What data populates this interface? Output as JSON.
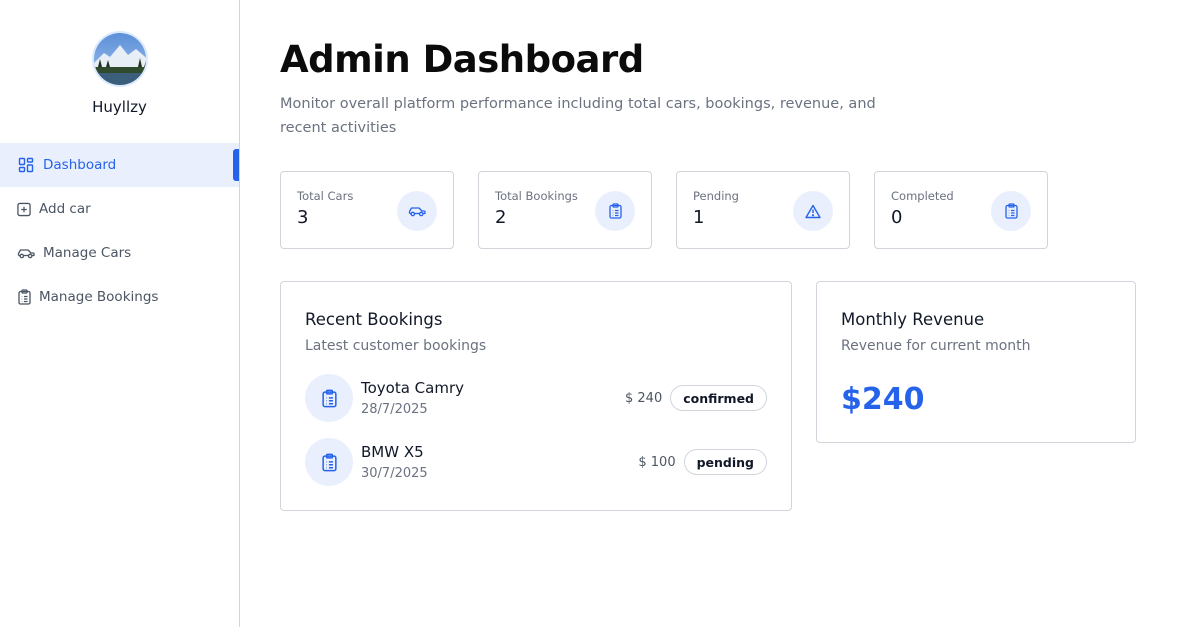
{
  "user": {
    "name": "Huyllzy"
  },
  "sidebar": {
    "items": [
      {
        "label": "Dashboard",
        "icon": "dashboard-icon",
        "active": true
      },
      {
        "label": "Add car",
        "icon": "add-square-icon",
        "active": false
      },
      {
        "label": "Manage Cars",
        "icon": "car-icon",
        "active": false
      },
      {
        "label": "Manage Bookings",
        "icon": "clipboard-icon",
        "active": false
      }
    ]
  },
  "header": {
    "title": "Admin Dashboard",
    "subtitle": "Monitor overall platform performance including total cars, bookings, revenue, and recent activities"
  },
  "stats": [
    {
      "label": "Total Cars",
      "value": "3",
      "icon": "car-icon"
    },
    {
      "label": "Total Bookings",
      "value": "2",
      "icon": "clipboard-icon"
    },
    {
      "label": "Pending",
      "value": "1",
      "icon": "warning-icon"
    },
    {
      "label": "Completed",
      "value": "0",
      "icon": "clipboard-icon"
    }
  ],
  "recent_bookings": {
    "title": "Recent Bookings",
    "subtitle": "Latest customer bookings",
    "items": [
      {
        "car": "Toyota Camry",
        "date": "28/7/2025",
        "price": "$ 240",
        "status": "confirmed"
      },
      {
        "car": "BMW X5",
        "date": "30/7/2025",
        "price": "$ 100",
        "status": "pending"
      }
    ]
  },
  "revenue": {
    "title": "Monthly Revenue",
    "subtitle": "Revenue for current month",
    "value": "$240"
  },
  "colors": {
    "accent": "#2563eb",
    "accent_soft": "#e9effd",
    "border": "#d1d5db",
    "muted": "#6b7280"
  }
}
